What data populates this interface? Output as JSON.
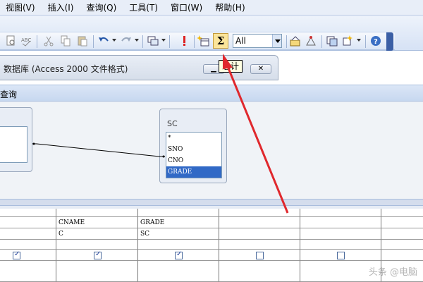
{
  "menu": [
    "视图(V)",
    "插入(I)",
    "查询(Q)",
    "工具(T)",
    "窗口(W)",
    "帮助(H)"
  ],
  "toolbar": {
    "top_values": "All",
    "tooltip": "总计"
  },
  "window": {
    "title": "数据库 (Access 2000 文件格式)"
  },
  "query": {
    "title": "查询"
  },
  "field_lists": [
    {
      "title": "",
      "fields": []
    },
    {
      "title": "SC",
      "fields": [
        "*",
        "SNO",
        "CNO",
        "GRADE"
      ],
      "selected": "GRADE"
    }
  ],
  "grid": {
    "columns": [
      {
        "field": "",
        "table": "",
        "show": true
      },
      {
        "field": "CNAME",
        "table": "C",
        "show": true
      },
      {
        "field": "GRADE",
        "table": "SC",
        "show": true
      },
      {
        "field": "",
        "table": "",
        "show": false
      },
      {
        "field": "",
        "table": "",
        "show": false
      }
    ]
  },
  "watermark": "头条 @电脑",
  "colors": {
    "highlight": "#3169c6",
    "arrow": "#e0282d"
  }
}
